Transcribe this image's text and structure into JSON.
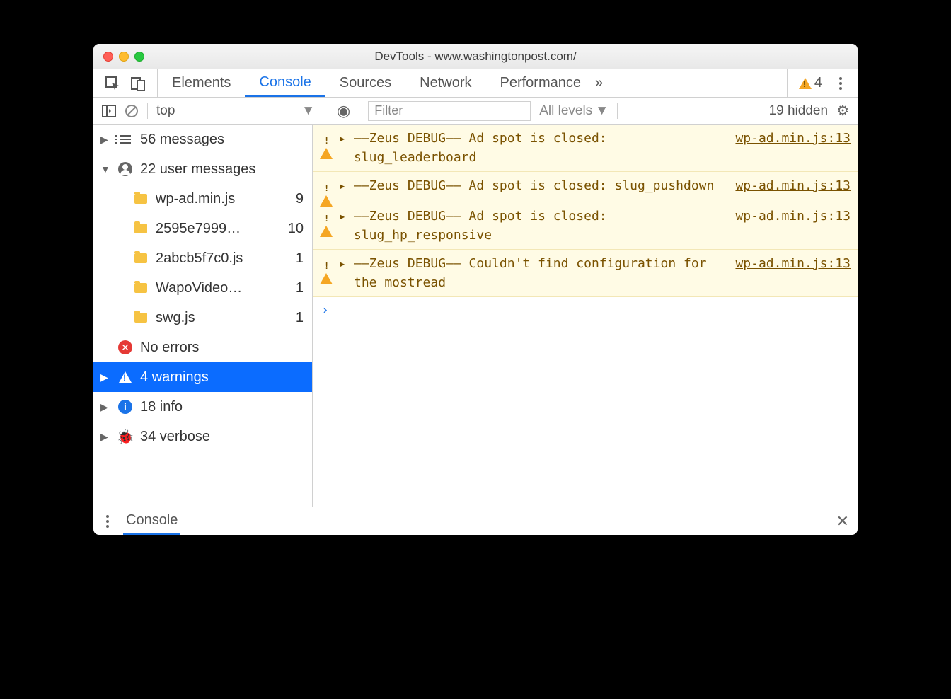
{
  "window": {
    "title": "DevTools - www.washingtonpost.com/"
  },
  "tabs": {
    "items": [
      "Elements",
      "Console",
      "Sources",
      "Network",
      "Performance"
    ],
    "active": 1,
    "overflow": "»",
    "warn_count": "4"
  },
  "toolbar": {
    "context": "top",
    "filter_placeholder": "Filter",
    "levels": "All levels",
    "hidden": "19 hidden"
  },
  "sidebar": {
    "messages": {
      "label": "56 messages"
    },
    "user": {
      "label": "22 user messages"
    },
    "files": [
      {
        "name": "wp-ad.min.js",
        "count": "9"
      },
      {
        "name": "2595e7999…",
        "count": "10"
      },
      {
        "name": "2abcb5f7c0.js",
        "count": "1"
      },
      {
        "name": "WapoVideo…",
        "count": "1"
      },
      {
        "name": "swg.js",
        "count": "1"
      }
    ],
    "errors": {
      "label": "No errors"
    },
    "warnings": {
      "label": "4 warnings"
    },
    "info": {
      "label": "18 info"
    },
    "verbose": {
      "label": "34 verbose"
    }
  },
  "messages": [
    {
      "text": "––Zeus DEBUG–– Ad spot is closed: slug_leaderboard",
      "src": "wp-ad.min.js:13"
    },
    {
      "text": "––Zeus DEBUG–– Ad spot is closed: slug_pushdown",
      "src": "wp-ad.min.js:13"
    },
    {
      "text": "––Zeus DEBUG–– Ad spot is closed: slug_hp_responsive",
      "src": "wp-ad.min.js:13"
    },
    {
      "text": "––Zeus DEBUG–– Couldn't find configuration for the mostread",
      "src": "wp-ad.min.js:13"
    }
  ],
  "drawer": {
    "tab": "Console"
  }
}
